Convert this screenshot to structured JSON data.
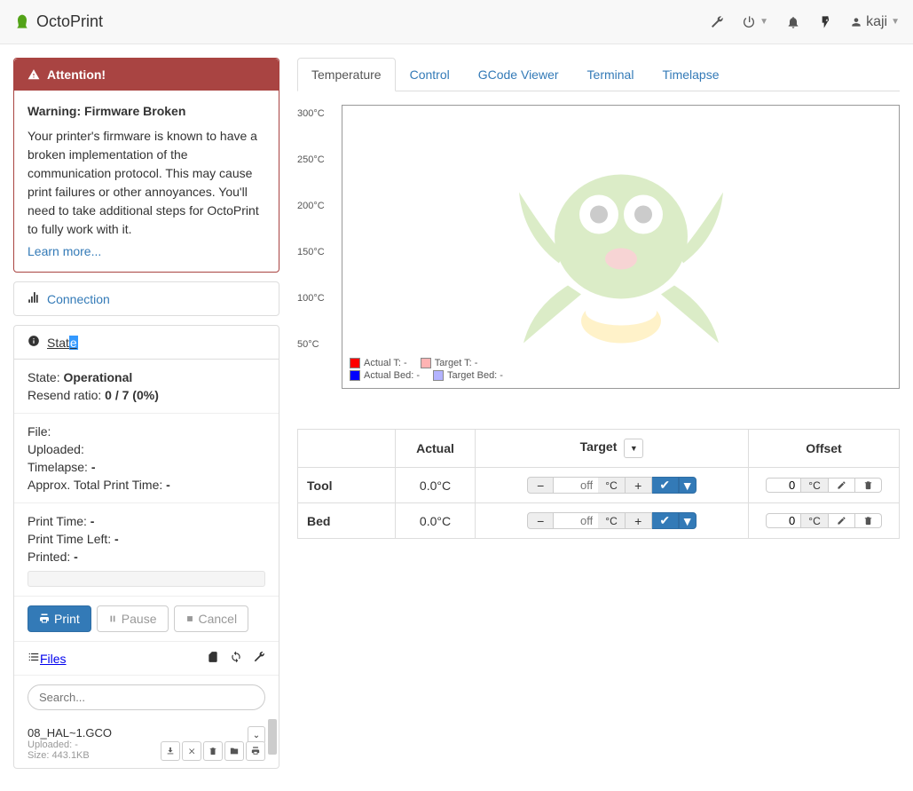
{
  "brand": "OctoPrint",
  "user": "kaji",
  "alert": {
    "title": "Attention!",
    "heading": "Warning: Firmware Broken",
    "body": "Your printer's firmware is known to have a broken implementation of the communication protocol. This may cause print failures or other annoyances. You'll need to take additional steps for OctoPrint to fully work with it.",
    "link": "Learn more..."
  },
  "sidebar": {
    "connection": "Connection",
    "state": "State",
    "files": "Files"
  },
  "state": {
    "label_state": "State:",
    "value_state": "Operational",
    "label_resend": "Resend ratio:",
    "value_resend": "0 / 7 (0%)",
    "label_file": "File:",
    "label_uploaded": "Uploaded:",
    "label_timelapse": "Timelapse:",
    "value_timelapse": "-",
    "label_approx": "Approx. Total Print Time:",
    "value_approx": "-",
    "label_printtime": "Print Time:",
    "value_printtime": "-",
    "label_printleft": "Print Time Left:",
    "value_printleft": "-",
    "label_printed": "Printed:",
    "value_printed": "-"
  },
  "buttons": {
    "print": "Print",
    "pause": "Pause",
    "cancel": "Cancel"
  },
  "search": {
    "placeholder": "Search..."
  },
  "file": {
    "name": "08_HAL~1.GCO",
    "uploaded_label": "Uploaded:",
    "uploaded_value": "-",
    "size_label": "Size:",
    "size_value": "443.1KB"
  },
  "tabs": [
    "Temperature",
    "Control",
    "GCode Viewer",
    "Terminal",
    "Timelapse"
  ],
  "chart_data": {
    "type": "line",
    "y_ticks": [
      "300°C",
      "250°C",
      "200°C",
      "150°C",
      "100°C",
      "50°C"
    ],
    "ylim": [
      0,
      300
    ],
    "series": [
      {
        "name": "Actual T",
        "color": "#ff0000",
        "values": []
      },
      {
        "name": "Target T",
        "color": "#ffb3b3",
        "values": []
      },
      {
        "name": "Actual Bed",
        "color": "#0000ff",
        "values": []
      },
      {
        "name": "Target Bed",
        "color": "#b3b3ff",
        "values": []
      }
    ],
    "legend": {
      "actual_t": "Actual T: -",
      "target_t": "Target T: -",
      "actual_bed": "Actual Bed: -",
      "target_bed": "Target Bed: -"
    }
  },
  "temp_table": {
    "headers": {
      "actual": "Actual",
      "target": "Target",
      "offset": "Offset"
    },
    "rows": [
      {
        "label": "Tool",
        "actual": "0.0°C",
        "target_placeholder": "off",
        "unit": "°C",
        "offset": "0"
      },
      {
        "label": "Bed",
        "actual": "0.0°C",
        "target_placeholder": "off",
        "unit": "°C",
        "offset": "0"
      }
    ]
  }
}
